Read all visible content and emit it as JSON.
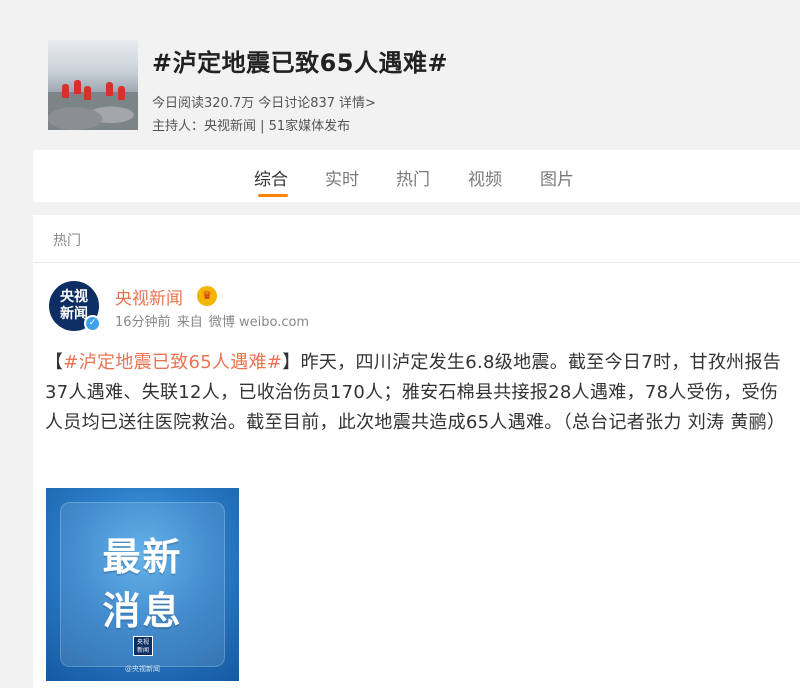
{
  "topic": {
    "title": "#泸定地震已致65人遇难#",
    "cover_caption": "",
    "stats": {
      "read": "今日阅读320.7万",
      "discuss": "今日讨论837",
      "details_link": "详情>"
    },
    "host": "主持人：央视新闻 | 51家媒体发布"
  },
  "tabs": [
    {
      "label": "综合",
      "active": true
    },
    {
      "label": "实时",
      "active": false
    },
    {
      "label": "热门",
      "active": false
    },
    {
      "label": "视频",
      "active": false
    },
    {
      "label": "图片",
      "active": false
    }
  ],
  "feed": {
    "section_label": "热门",
    "post": {
      "avatar_text_line1": "央视",
      "avatar_text_line2": "新闻",
      "author": "央视新闻",
      "time": "16分钟前",
      "source_prefix": "来自",
      "source": "微博 weibo.com",
      "text_prefix": "【",
      "topic_link": "#泸定地震已致65人遇难#",
      "text_body": "】昨天，四川泸定发生6.8级地震。截至今日7时，甘孜州报告37人遇难、失联12人，已收治伤员170人；雅安石棉县共接报28人遇难，78人受伤，受伤人员均已送往医院救治。截至目前，此次地震共造成65人遇难。（总台记者张力 刘涛 黄鹂）",
      "image": {
        "line1": "最新",
        "line2": "消息",
        "logo_line1": "央视",
        "logo_line2": "新闻",
        "watermark": "@央视新闻"
      }
    }
  },
  "colors": {
    "accent": "#ff8200",
    "link": "#eb7350",
    "avatar_bg": "#0d2e63",
    "verified": "#3ea2ea"
  }
}
